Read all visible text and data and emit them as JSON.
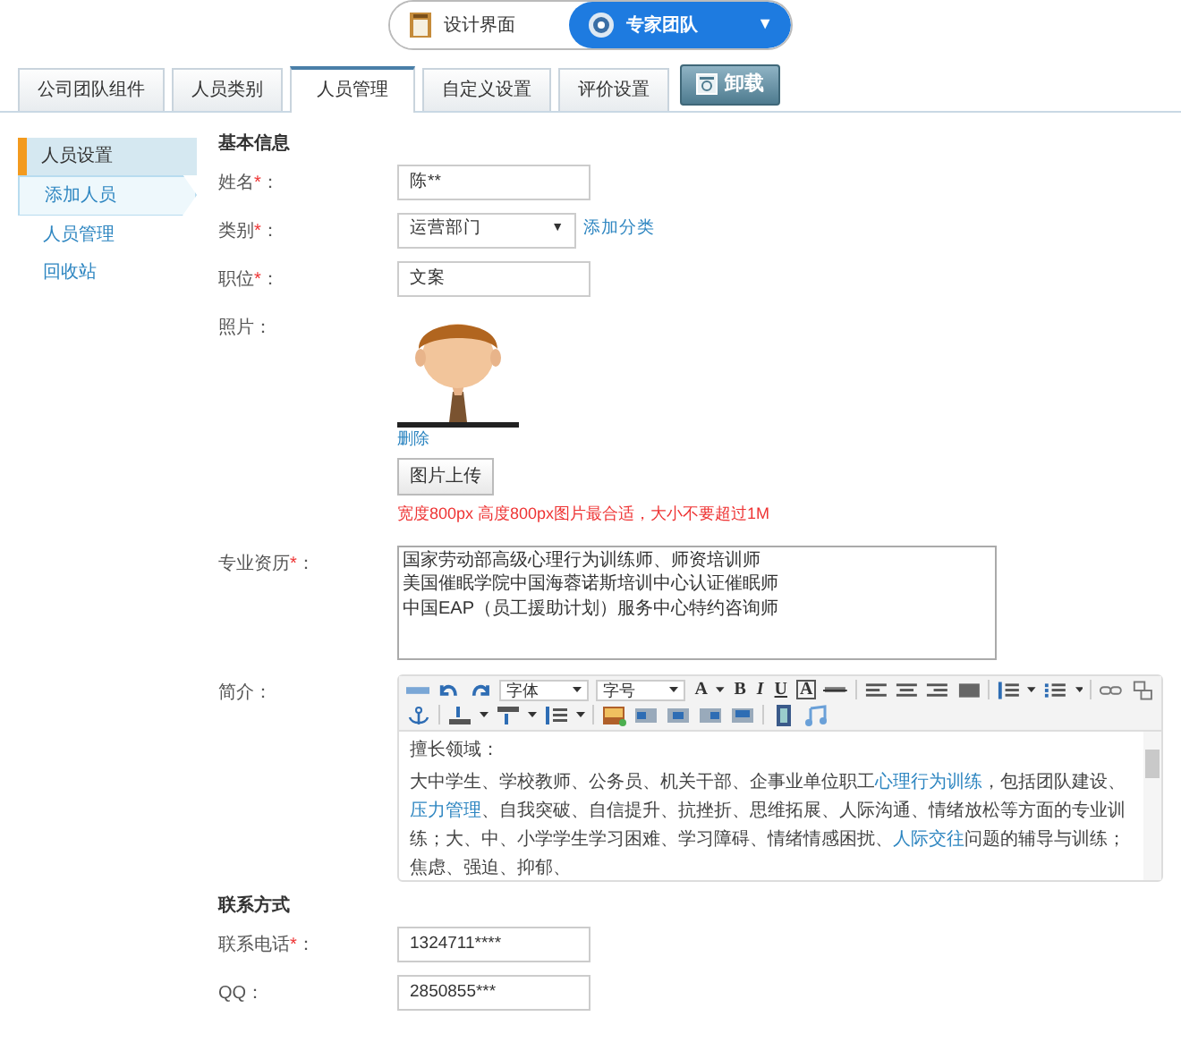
{
  "mode_switch": [
    {
      "label": "设计界面",
      "selected": false
    },
    {
      "label": "专家团队",
      "selected": true,
      "caret": "▼"
    }
  ],
  "tabs": [
    {
      "label": "公司团队组件",
      "selected": false
    },
    {
      "label": "人员类别",
      "selected": false
    },
    {
      "label": "人员管理",
      "selected": true
    },
    {
      "label": "自定义设置",
      "selected": false
    },
    {
      "label": "评价设置",
      "selected": false
    }
  ],
  "uninstall_button": {
    "label": "卸载"
  },
  "sidebar": {
    "heading": "人员设置",
    "items": [
      {
        "label": "添加人员",
        "selected": true
      },
      {
        "label": "人员管理",
        "selected": false
      },
      {
        "label": "回收站",
        "selected": false
      }
    ]
  },
  "sections": [
    {
      "title": "基本信息",
      "fields": [
        {
          "kind": "input",
          "label": "姓名",
          "required_mark": "*",
          "colon": "：",
          "value": "陈**"
        },
        {
          "kind": "select",
          "label": "类别",
          "required_mark": "*",
          "colon": "：",
          "value": "运营部门",
          "caret": "▼",
          "link": "添加分类"
        },
        {
          "kind": "input",
          "label": "职位",
          "required_mark": "*",
          "colon": "：",
          "value": "文案"
        },
        {
          "label": "照片",
          "colon": "：",
          "delete_link": "删除",
          "upload_button": "图片上传",
          "hint": "宽度800px 高度800px图片最合适，大小不要超过1M"
        },
        {
          "kind": "textarea",
          "label": "专业资历",
          "required_mark": "*",
          "colon": "：",
          "lines": [
            "国家劳动部高级心理行为训练师、师资培训师",
            "美国催眠学院中国海蓉诺斯培训中心认证催眠师",
            "中国EAP（员工援助计划）服务中心特约咨询师"
          ]
        },
        {
          "kind": "editor",
          "label": "简介",
          "colon": "：",
          "font_select": "字体",
          "size_select": "字号",
          "glyphs": [
            "A",
            "B",
            "I",
            "U",
            "A"
          ],
          "paragraphs": [
            [
              {
                "text": "擅长领域：",
                "link": false
              }
            ],
            [
              {
                "text": "大中学生、学校教师、公务员、机关干部、企事业单位职工",
                "link": false
              },
              {
                "text": "心理行为训练",
                "link": true
              },
              {
                "text": "，包括团队建设、",
                "link": false
              },
              {
                "text": "压力管理",
                "link": true
              },
              {
                "text": "、自我突破、自信提升、抗挫折、思维拓展、人际沟通、情绪放松等方面的专业训练；大、中、小学学生学习困难、学习障碍、情绪情感困扰、",
                "link": false
              },
              {
                "text": "人际交往",
                "link": true
              },
              {
                "text": "问题的辅导与训练；焦虑、强迫、抑郁、",
                "link": false
              }
            ]
          ]
        }
      ]
    },
    {
      "title": "联系方式",
      "fields": [
        {
          "kind": "input",
          "label": "联系电话",
          "required_mark": "*",
          "colon": "：",
          "value": "1324711****"
        },
        {
          "kind": "input",
          "label": "QQ",
          "colon": "：",
          "value": "2850855***"
        }
      ]
    }
  ]
}
